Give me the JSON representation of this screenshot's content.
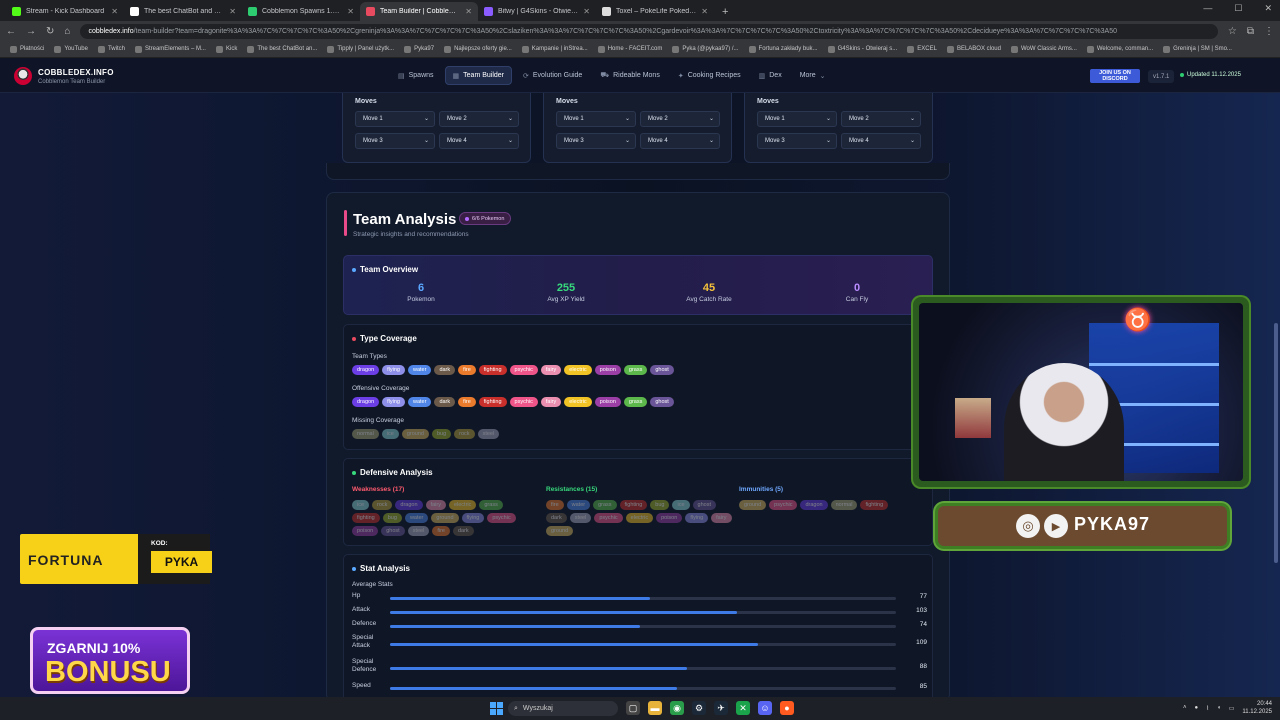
{
  "browser": {
    "tabs": [
      {
        "title": "Stream - Kick Dashboard",
        "color": "#53fc18",
        "active": false
      },
      {
        "title": "The best ChatBot and Widg",
        "color": "#ffffff",
        "active": false
      },
      {
        "title": "Cobblemon Spawns 1.5.2 - Arti",
        "color": "#2ecc71",
        "active": false
      },
      {
        "title": "Team Builder | Cobblemon Po",
        "color": "#e84a5f",
        "active": true
      },
      {
        "title": "Bitwy | G4Skins - Otwieraj skrz",
        "color": "#8a5cff",
        "active": false
      },
      {
        "title": "Toxel – PokeLife Pokedex",
        "color": "#dddddd",
        "active": false
      }
    ],
    "url_domain": "cobbledex.info",
    "url_path": "/team-builder?team=dragonite%3A%3A%7C%7C%7C%7C%3A50%2Cgreninja%3A%3A%7C%7C%7C%7C%3A50%2Cslaziken%3A%3A%7C%7C%7C%7C%3A50%2Cgardevoir%3A%3A%7C%7C%7C%7C%3A50%2Ctoxtricity%3A%3A%7C%7C%7C%7C%3A50%2Cdecidueye%3A%3A%7C%7C%7C%7C%3A50",
    "bookmarks": [
      "Płatności",
      "YouTube",
      "Twitch",
      "StreamElements – M...",
      "Kick",
      "The best ChatBot an...",
      "Tipply | Panel użytk...",
      "Pyka97",
      "Najlepsze oferty gie...",
      "Kampanie | inStrea...",
      "Home - FACEIT.com",
      "Pyka (@pykaa97) /...",
      "Fortuna zakłady buk...",
      "G4Skins - Otwieraj s...",
      "EXCEL",
      "BELABOX cloud",
      "WoW Classic Arms...",
      "Welcome, comman...",
      "Greninja | SM | Smo..."
    ]
  },
  "site": {
    "name": "COBBLEDEX.INFO",
    "subtitle": "Cobblemon Team Builder",
    "nav": [
      {
        "label": "Spawns",
        "icon": "▤",
        "active": false
      },
      {
        "label": "Team Builder",
        "icon": "▦",
        "active": true
      },
      {
        "label": "Evolution Guide",
        "icon": "⟳",
        "active": false
      },
      {
        "label": "Rideable Mons",
        "icon": "⛟",
        "active": false
      },
      {
        "label": "Cooking Recipes",
        "icon": "✦",
        "active": false
      },
      {
        "label": "Dex",
        "icon": "▥",
        "active": false
      },
      {
        "label": "More",
        "icon": "",
        "active": false
      }
    ],
    "discord_label": "JOIN US ON DISCORD",
    "version": "v1.7.1",
    "updated": "Updated 11.12.2025"
  },
  "movecards": {
    "label": "Moves",
    "moves": [
      "Move 1",
      "Move 2",
      "Move 3",
      "Move 4"
    ]
  },
  "analysis": {
    "title": "Team Analysis",
    "badge": "6/6 Pokemon",
    "subtitle": "Strategic insights and recommendations",
    "overview": {
      "title": "Team Overview",
      "stats": [
        {
          "value": "6",
          "label": "Pokemon",
          "color": "#5aa8ff"
        },
        {
          "value": "255",
          "label": "Avg XP Yield",
          "color": "#37d97c"
        },
        {
          "value": "45",
          "label": "Avg Catch Rate",
          "color": "#f5c23a"
        },
        {
          "value": "0",
          "label": "Can Fly",
          "color": "#b98cff"
        }
      ]
    },
    "coverage": {
      "title": "Type Coverage",
      "team_types_label": "Team Types",
      "team_types": [
        "dragon",
        "flying",
        "water",
        "dark",
        "fire",
        "fighting",
        "psychic",
        "fairy",
        "electric",
        "poison",
        "grass",
        "ghost"
      ],
      "offensive_label": "Offensive Coverage",
      "offensive": [
        "dragon",
        "flying",
        "water",
        "dark",
        "fire",
        "fighting",
        "psychic",
        "fairy",
        "electric",
        "poison",
        "grass",
        "ghost"
      ],
      "missing_label": "Missing Coverage",
      "missing": [
        "normal",
        "ice",
        "ground",
        "bug",
        "rock",
        "steel"
      ]
    },
    "defensive": {
      "title": "Defensive Analysis",
      "weak_label": "Weaknesses (17)",
      "weak": [
        "ice",
        "rock",
        "dragon",
        "fairy",
        "electric",
        "grass",
        "fighting",
        "bug",
        "water",
        "ground",
        "flying",
        "psychic",
        "poison",
        "ghost",
        "steel",
        "fire",
        "dark"
      ],
      "resist_label": "Resistances (15)",
      "resist": [
        "fire",
        "water",
        "grass",
        "fighting",
        "bug",
        "ice",
        "ghost",
        "dark",
        "steel",
        "psychic",
        "electric",
        "poison",
        "flying",
        "fairy",
        "ground"
      ],
      "immune_label": "Immunities (5)",
      "immune": [
        "ground",
        "psychic",
        "dragon",
        "normal",
        "fighting"
      ]
    },
    "stats": {
      "title": "Stat Analysis",
      "avg_label": "Average Stats",
      "max": 150,
      "rows": [
        {
          "name": "Hp",
          "value": 77
        },
        {
          "name": "Attack",
          "value": 103
        },
        {
          "name": "Defence",
          "value": 74
        },
        {
          "name": "Special Attack",
          "value": 109
        },
        {
          "name": "Special Defence",
          "value": 88
        },
        {
          "name": "Speed",
          "value": 85
        }
      ]
    }
  },
  "type_colors": {
    "dragon": "#6b3ee6",
    "flying": "#8e8fe8",
    "water": "#4f86e8",
    "dark": "#6b5a4a",
    "fire": "#ea7a2c",
    "fighting": "#c9302c",
    "psychic": "#f0558a",
    "fairy": "#ea8fb0",
    "electric": "#f2c325",
    "poison": "#9b3fa6",
    "grass": "#5cb84a",
    "ghost": "#6a5598",
    "normal": "#a8a878",
    "ice": "#8ad4d8",
    "ground": "#d8b85e",
    "bug": "#9db02a",
    "rock": "#b8a03a",
    "steel": "#a8a8c0"
  },
  "overlay": {
    "name": "PYKA97",
    "fortuna": "FORTUNA",
    "kod_label": "KOD:",
    "code": "PYKA",
    "bonus_top": "ZGARNIJ 10%",
    "bonus_bottom": "BONUSU"
  },
  "taskbar": {
    "search_placeholder": "Wyszukaj",
    "time": "20:44",
    "date": "11.12.2025"
  }
}
